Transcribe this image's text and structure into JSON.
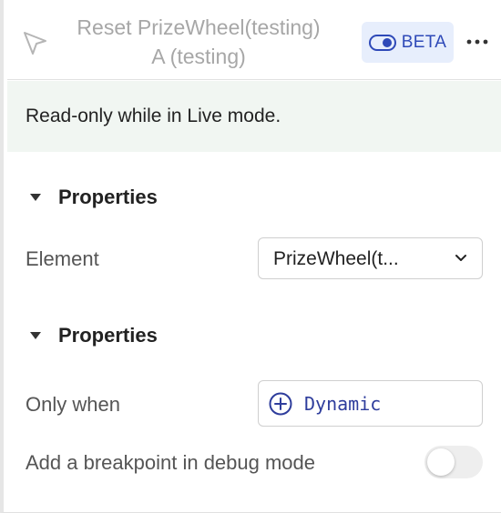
{
  "header": {
    "title_line1": "Reset PrizeWheel(testing)",
    "title_line2": "A (testing)",
    "beta_label": "BETA"
  },
  "notice": {
    "text": "Read-only while in Live mode."
  },
  "sections": [
    {
      "title": "Properties",
      "element_label": "Element",
      "element_value": "PrizeWheel(t..."
    },
    {
      "title": "Properties",
      "only_when_label": "Only when",
      "dynamic_label": "Dynamic",
      "breakpoint_label": "Add a breakpoint in debug mode",
      "breakpoint_enabled": false
    }
  ],
  "icons": {
    "cursor": "cursor-arrow-icon",
    "beta": "toggle-icon",
    "more": "more-horizontal-icon",
    "collapse": "triangle-down-icon",
    "dropdown": "chevron-down-icon",
    "dynamic": "plus-circle-icon"
  },
  "colors": {
    "accent": "#2e49b8",
    "beta_bg": "#e7eefc",
    "notice_bg": "#f1f6f2",
    "dynamic_text": "#2e3d9c"
  }
}
